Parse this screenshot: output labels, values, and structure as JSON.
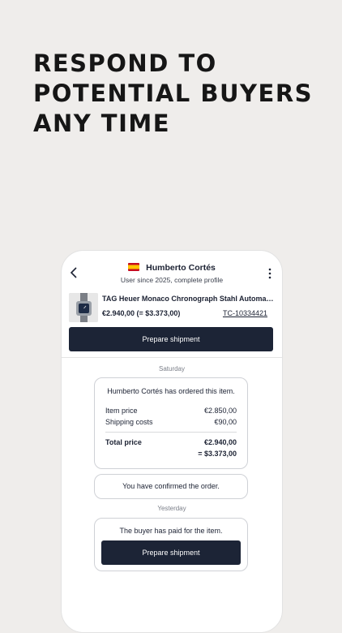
{
  "headline": [
    "RESPOND TO",
    "POTENTIAL BUYERS",
    "ANY TIME"
  ],
  "chat": {
    "user_name": "Humberto Cortés",
    "user_subtitle": "User since 2025, complete profile",
    "flag": "spain-flag"
  },
  "product": {
    "name": "TAG Heuer Monaco Chronograph Stahl Automa…",
    "price": "€2.940,00 (= $3.373,00)",
    "reference": "TC-10334421",
    "button_label": "Prepare shipment"
  },
  "messages": {
    "day1": "Saturday",
    "order_title": "Humberto Cortés has ordered this item.",
    "item_price_label": "Item price",
    "item_price_value": "€2.850,00",
    "shipping_label": "Shipping costs",
    "shipping_value": "€90,00",
    "total_label": "Total price",
    "total_value": "€2.940,00",
    "total_converted": "= $3.373,00",
    "confirmed_text": "You have confirmed the order.",
    "day2": "Yesterday",
    "paid_text": "The buyer has paid for the item.",
    "paid_button_label": "Prepare shipment"
  },
  "colors": {
    "background": "#efedeb",
    "primary_button": "#1c2436"
  }
}
